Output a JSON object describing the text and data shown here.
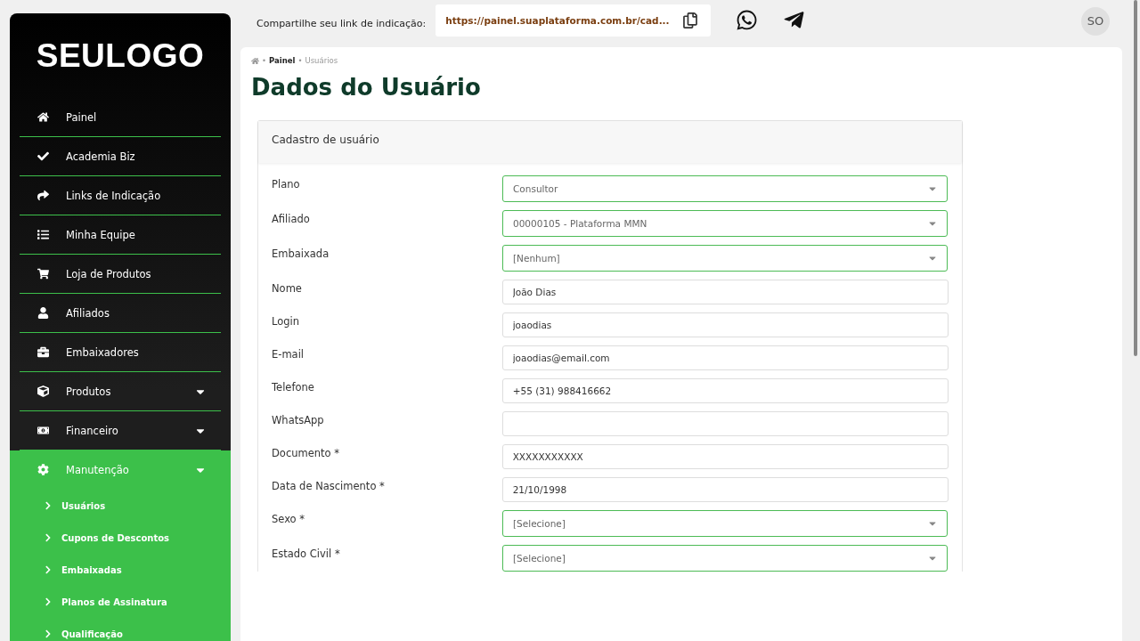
{
  "sidebar": {
    "logo": "SEULOGO",
    "items": [
      {
        "label": "Painel",
        "kind": "link"
      },
      {
        "label": "Academia Biz",
        "kind": "link"
      },
      {
        "label": "Links de Indicação",
        "kind": "link"
      },
      {
        "label": "Minha Equipe",
        "kind": "link"
      },
      {
        "label": "Loja de Produtos",
        "kind": "link"
      },
      {
        "label": "Afiliados",
        "kind": "link"
      },
      {
        "label": "Embaixadores",
        "kind": "link"
      },
      {
        "label": "Produtos",
        "kind": "group",
        "expanded": false
      },
      {
        "label": "Financeiro",
        "kind": "group",
        "expanded": false
      },
      {
        "label": "Manutenção",
        "kind": "group",
        "expanded": true,
        "children": [
          {
            "label": "Usuários"
          },
          {
            "label": "Cupons de Descontos"
          },
          {
            "label": "Embaixadas"
          },
          {
            "label": "Planos de Assinatura"
          },
          {
            "label": "Qualificação"
          }
        ]
      }
    ]
  },
  "topbar": {
    "share_label": "Compartilhe seu link de indicação:",
    "link": "https://painel.suaplataforma.com.br/cad...",
    "avatar": "SO"
  },
  "breadcrumb": {
    "separator": "•",
    "items": [
      "Painel",
      "Usuários"
    ]
  },
  "page_title": "Dados do Usuário",
  "form": {
    "title": "Cadastro de usuário",
    "fields": [
      {
        "label": "Plano",
        "kind": "select",
        "value": "Consultor"
      },
      {
        "label": "Afiliado",
        "kind": "select",
        "value": "00000105 - Plataforma MMN"
      },
      {
        "label": "Embaixada",
        "kind": "select",
        "value": "[Nenhum]"
      },
      {
        "label": "Nome",
        "kind": "text",
        "value": "João Dias"
      },
      {
        "label": "Login",
        "kind": "text",
        "value": "joaodias"
      },
      {
        "label": "E-mail",
        "kind": "text",
        "value": "joaodias@email.com"
      },
      {
        "label": "Telefone",
        "kind": "text",
        "value": "+55 (31) 988416662"
      },
      {
        "label": "WhatsApp",
        "kind": "text"
      },
      {
        "label": "Documento *",
        "kind": "text",
        "value": "XXXXXXXXXXX"
      },
      {
        "label": "Data de Nascimento *",
        "kind": "text",
        "value": "21/10/1998"
      },
      {
        "label": "Sexo *",
        "kind": "select",
        "value": "[Selecione]"
      },
      {
        "label": "Estado Civil *",
        "kind": "select",
        "value": "[Selecione]"
      }
    ]
  }
}
